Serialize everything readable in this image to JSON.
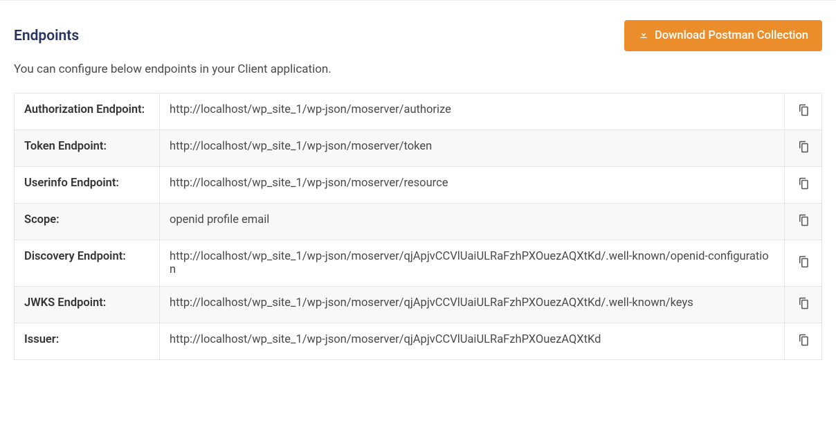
{
  "header": {
    "title": "Endpoints",
    "download_button_label": "Download Postman Collection"
  },
  "description": "You can configure below endpoints in your Client application.",
  "endpoints": [
    {
      "label": "Authorization Endpoint:",
      "value": "http://localhost/wp_site_1/wp-json/moserver/authorize"
    },
    {
      "label": "Token Endpoint:",
      "value": "http://localhost/wp_site_1/wp-json/moserver/token"
    },
    {
      "label": "Userinfo Endpoint:",
      "value": "http://localhost/wp_site_1/wp-json/moserver/resource"
    },
    {
      "label": "Scope:",
      "value": "openid profile email"
    },
    {
      "label": "Discovery Endpoint:",
      "value": "http://localhost/wp_site_1/wp-json/moserver/qjApjvCCVlUaiULRaFzhPXOuezAQXtKd/.well-known/openid-configuration"
    },
    {
      "label": "JWKS Endpoint:",
      "value": "http://localhost/wp_site_1/wp-json/moserver/qjApjvCCVlUaiULRaFzhPXOuezAQXtKd/.well-known/keys"
    },
    {
      "label": "Issuer:",
      "value": "http://localhost/wp_site_1/wp-json/moserver/qjApjvCCVlUaiULRaFzhPXOuezAQXtKd"
    }
  ]
}
